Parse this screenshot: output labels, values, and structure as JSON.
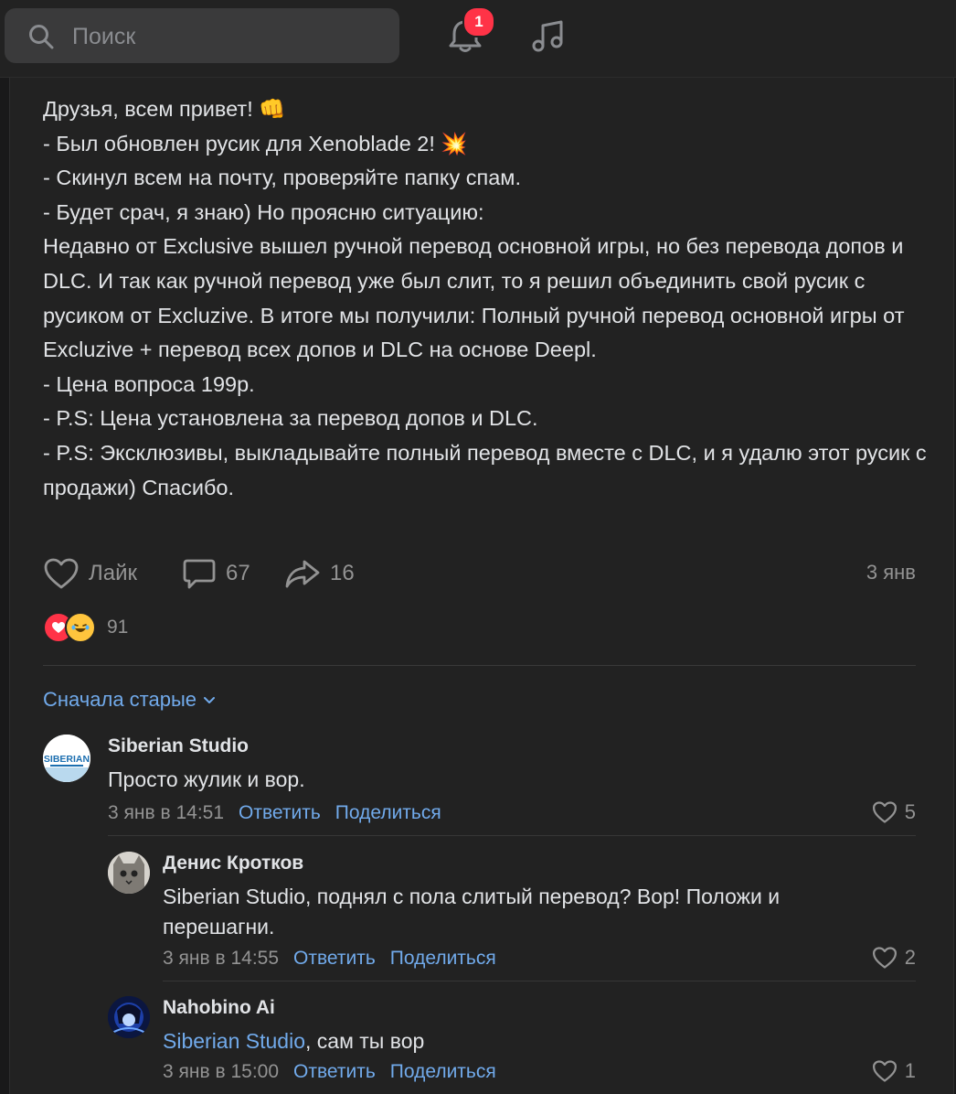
{
  "search": {
    "placeholder": "Поиск"
  },
  "notifications": {
    "badge": "1"
  },
  "post": {
    "lines": [
      "Друзья, всем привет! 👊",
      "- Был обновлен русик для Xenoblade 2! 💥",
      "- Скинул всем на почту, проверяйте папку спам.",
      "- Будет срач, я знаю) Но проясню ситуацию:",
      "Недавно от Exclusive вышел ручной перевод основной игры, но без перевода допов и DLC. И так как ручной перевод уже был слит, то я решил объединить свой русик с русиком от Excluzive. В итоге мы получили: Полный ручной перевод основной игры от Excluzive + перевод всех допов и DLC на основе Deepl.",
      "- Цена вопроса 199р.",
      "- P.S: Цена установлена за перевод допов и DLC.",
      "- P.S: Эксклюзивы, выкладывайте полный перевод вместе с DLC, и я удалю этот русик с продажи) Спасибо."
    ],
    "like_label": "Лайк",
    "comments_count": "67",
    "shares_count": "16",
    "date": "3 янв",
    "reactions_count": "91"
  },
  "sort_label": "Сначала старые",
  "comments": [
    {
      "author": "Siberian Studio",
      "text": "Просто жулик и вор.",
      "date": "3 янв в 14:51",
      "reply": "Ответить",
      "share": "Поделиться",
      "likes": "5"
    },
    {
      "author": "Денис Кротков",
      "text": "Siberian Studio, поднял с пола слитый перевод? Вор! Положи и перешагни.",
      "date": "3 янв в 14:55",
      "reply": "Ответить",
      "share": "Поделиться",
      "likes": "2"
    },
    {
      "author": "Nahobino Ai",
      "mention": "Siberian Studio",
      "text_rest": ", сам ты вор",
      "date": "3 янв в 15:00",
      "reply": "Ответить",
      "share": "Поделиться",
      "likes": "1"
    }
  ],
  "avatar_text": "SIBERIAN"
}
